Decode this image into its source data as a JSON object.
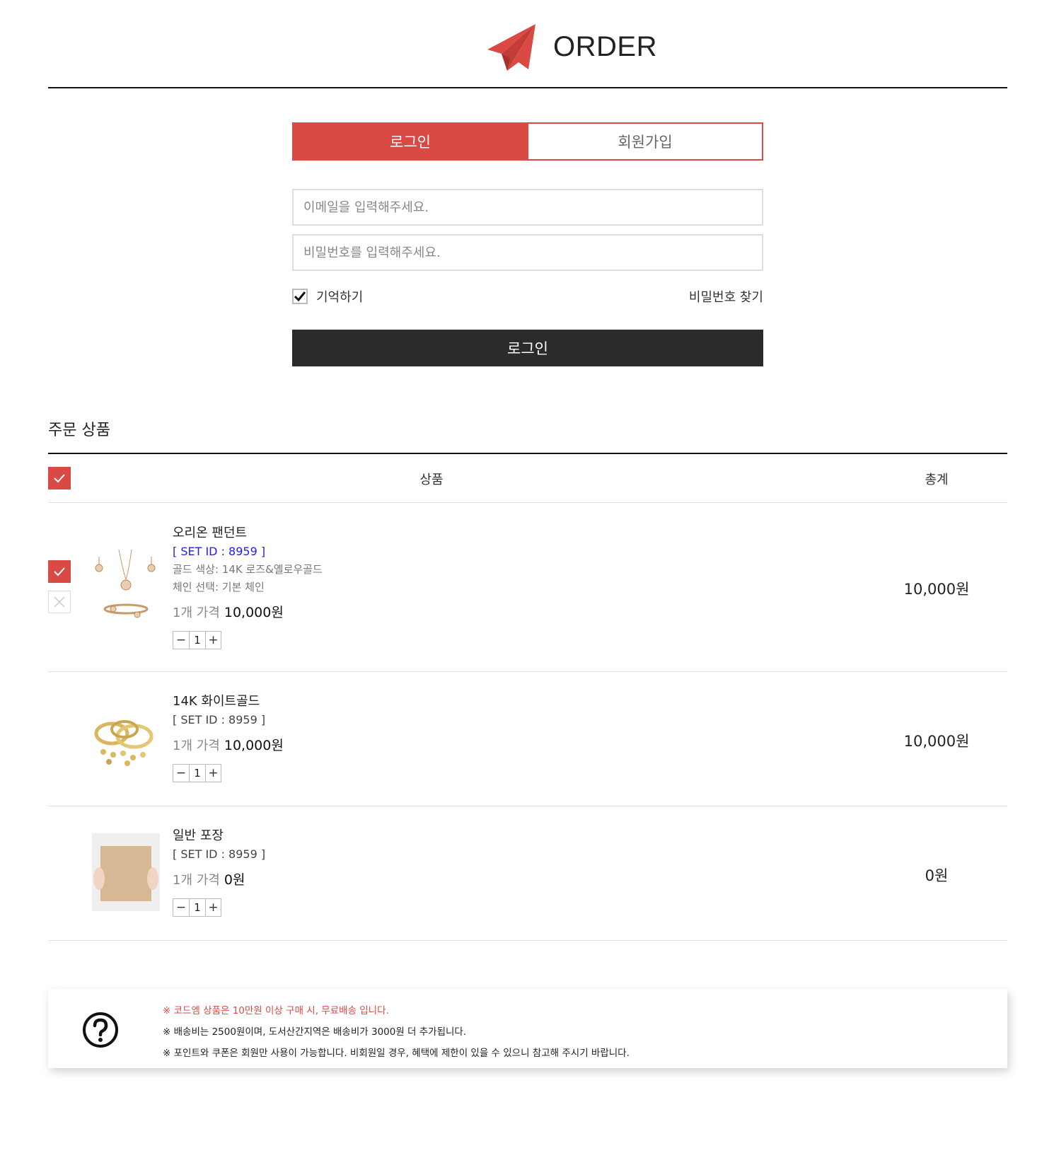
{
  "header": {
    "title": "ORDER",
    "icon": "paper-plane-icon",
    "accent": "#d94a45"
  },
  "auth": {
    "tabs": [
      {
        "label": "로그인",
        "active": true
      },
      {
        "label": "회원가입",
        "active": false
      }
    ],
    "email_placeholder": "이메일을 입력해주세요.",
    "password_placeholder": "비밀번호를 입력해주세요.",
    "remember_label": "기억하기",
    "remember_checked": true,
    "find_password": "비밀번호 찾기",
    "login_button": "로그인"
  },
  "order": {
    "section_title": "주문 상품",
    "columns": {
      "product": "상품",
      "total": "총계"
    },
    "items": [
      {
        "name": "오리온 팬던트",
        "set_id": "[ SET ID : 8959 ]",
        "options": [
          "골드 색상:  14K 로즈&옐로우골드",
          "체인 선택:  기본 체인"
        ],
        "unit_label": "1개 가격",
        "price": "10,000원",
        "qty": "1",
        "total": "10,000원"
      },
      {
        "name": "14K 화이트골드",
        "set_id": "[ SET ID : 8959 ]",
        "unit_label": "1개 가격",
        "price": "10,000원",
        "qty": "1",
        "total": "10,000원"
      },
      {
        "name": "일반 포장",
        "set_id": "[ SET ID : 8959 ]",
        "unit_label": "1개 가격",
        "price": "0원",
        "qty": "1",
        "total": "0원"
      }
    ],
    "qty_minus": "−",
    "qty_plus": "+"
  },
  "notice": {
    "icon": "question-circle-icon",
    "lines": [
      "※ 코드엠 상품은 10만원 이상 구매 시, 무료배송 입니다.",
      "※ 배송비는 2500원이며, 도서산간지역은 배송비가 3000원 더 추가됩니다.",
      "※ 포인트와 쿠폰은 회원만 사용이 가능합니다. 비회원일 경우, 혜택에 제한이 있을 수 있으니 참고해 주시기 바랍니다."
    ]
  }
}
